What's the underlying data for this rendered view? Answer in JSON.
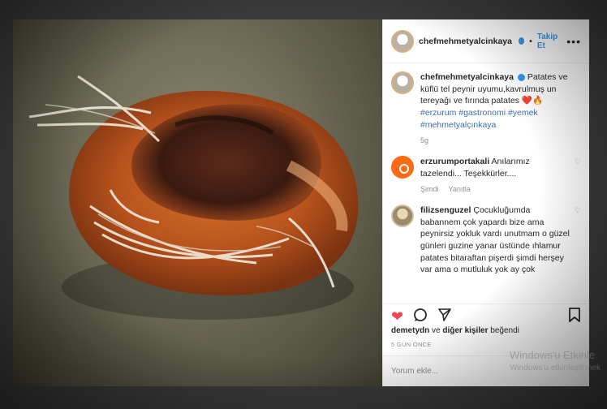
{
  "header": {
    "username": "chefmehmetyalcinkaya",
    "separator": "•",
    "follow_label": "Takip Et",
    "more_label": "•••"
  },
  "caption": {
    "username": "chefmehmetyalcinkaya",
    "text": "Patates ve küflü tel peynir uyumu,kavrulmuş un tereyağı ve fırında patates",
    "emoji": "❤️🔥",
    "hashtags": "#erzurum #gastronomi #yemek #mehmetyalçınkaya",
    "time": "5g"
  },
  "comments": [
    {
      "username": "erzurumportakali",
      "text": "Anılarımız tazelendi... Teşekkürler....",
      "time": "Şimdi",
      "reply_label": "Yanıtla"
    },
    {
      "username": "filizsenguzel",
      "text": "Çocukluğumda babannem çok yapardı bize ama peynirsiz yokluk vardı unutmam o güzel günleri guzine yanar üstünde ıhlamur patates bitaraftan pişerdi şimdi herşey var ama o mutluluk yok ay çok"
    }
  ],
  "likes": {
    "user": "demetydn",
    "connector": "ve",
    "others": "diğer kişiler",
    "suffix": "beğendi"
  },
  "timestamp": "5 GÜN ÖNCE",
  "comment_placeholder": "Yorum ekle...",
  "watermark": {
    "line1": "Windows'u Etkinle",
    "line2": "Windows'u etkinleştirmek"
  },
  "icons": [
    "heart-icon",
    "comment-icon",
    "share-icon",
    "bookmark-icon"
  ],
  "colors": {
    "accent": "#3897f0",
    "like": "#ed4956"
  }
}
